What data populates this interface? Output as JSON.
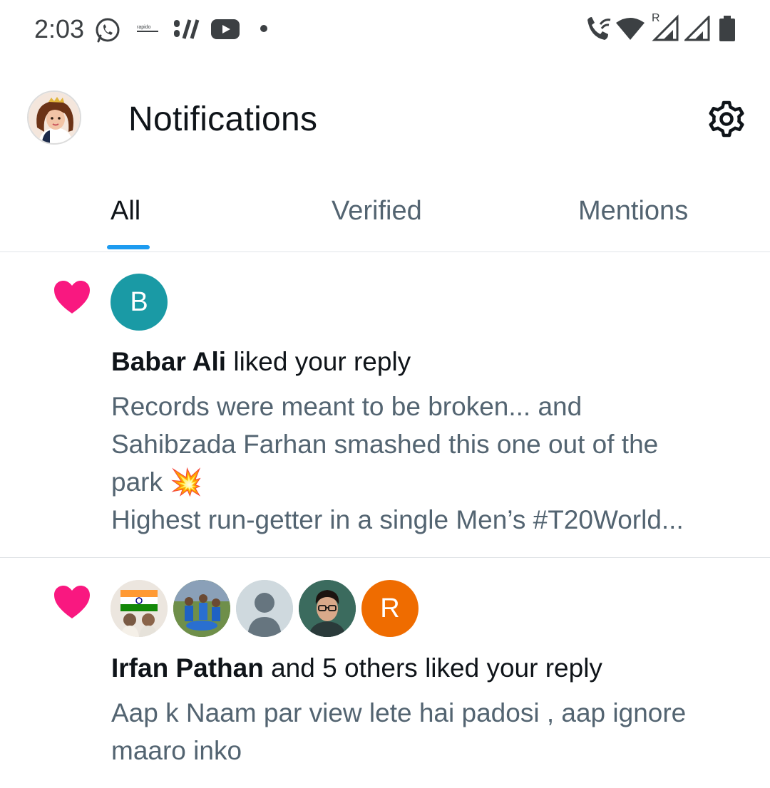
{
  "status_bar": {
    "time": "2:03",
    "rapido_label": "rapido",
    "network_label": "R",
    "icons": [
      "whatsapp-icon",
      "rapido-icon",
      "sound-bars-icon",
      "youtube-icon",
      "dot-icon",
      "wifi-calling-icon",
      "wifi-icon",
      "signal-icon",
      "signal-icon",
      "battery-icon"
    ]
  },
  "header": {
    "title": "Notifications",
    "settings_icon": "gear-icon"
  },
  "tabs": [
    {
      "label": "All",
      "active": true
    },
    {
      "label": "Verified",
      "active": false
    },
    {
      "label": "Mentions",
      "active": false
    }
  ],
  "notifications": [
    {
      "icon": "heart-icon",
      "avatars": [
        {
          "initial": "B",
          "color": "#1a9aa5"
        }
      ],
      "actor": "Babar Ali",
      "action": " liked your reply",
      "snippet": [
        "Records were meant to be broken... and",
        "Sahibzada Farhan smashed this one out of the",
        "park 💥",
        "Highest run-getter in a single Men’s #T20World..."
      ]
    },
    {
      "icon": "heart-icon",
      "avatars": [
        {
          "type": "flag-photo"
        },
        {
          "type": "team-photo"
        },
        {
          "type": "default-person"
        },
        {
          "type": "person-photo"
        },
        {
          "initial": "R",
          "color": "#ef6c00"
        }
      ],
      "actor": "Irfan Pathan",
      "action": " and 5 others liked your reply",
      "snippet": [
        "Aap k Naam par view lete hai padosi , aap ignore",
        "maaro inko"
      ]
    }
  ],
  "colors": {
    "accent": "#1d9bf0",
    "heart": "#f91880",
    "secondary_text": "#536471"
  }
}
